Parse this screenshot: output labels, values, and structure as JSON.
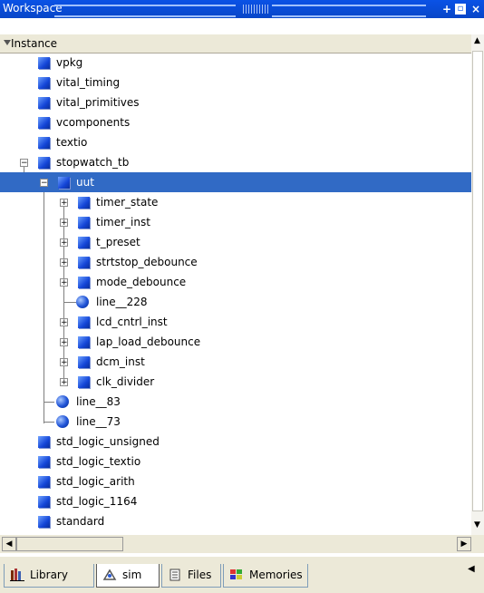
{
  "window": {
    "title": "Workspace",
    "add_glyph": "+",
    "restore_glyph": "▫",
    "close_glyph": "×"
  },
  "column_header": "Instance",
  "tree": [
    {
      "label": "vpkg",
      "icon": "module-icon"
    },
    {
      "label": "vital_timing",
      "icon": "module-icon"
    },
    {
      "label": "vital_primitives",
      "icon": "module-icon"
    },
    {
      "label": "vcomponents",
      "icon": "module-icon"
    },
    {
      "label": "textio",
      "icon": "module-icon"
    },
    {
      "label": "stopwatch_tb",
      "icon": "module-icon"
    },
    {
      "label": "uut",
      "icon": "module-icon"
    },
    {
      "label": "timer_state",
      "icon": "module-icon"
    },
    {
      "label": "timer_inst",
      "icon": "module-icon"
    },
    {
      "label": "t_preset",
      "icon": "module-icon"
    },
    {
      "label": "strtstop_debounce",
      "icon": "module-icon"
    },
    {
      "label": "mode_debounce",
      "icon": "module-icon"
    },
    {
      "label": "line__228",
      "icon": "process-icon"
    },
    {
      "label": "lcd_cntrl_inst",
      "icon": "module-icon"
    },
    {
      "label": "lap_load_debounce",
      "icon": "module-icon"
    },
    {
      "label": "dcm_inst",
      "icon": "module-icon"
    },
    {
      "label": "clk_divider",
      "icon": "module-icon"
    },
    {
      "label": "line__83",
      "icon": "process-icon"
    },
    {
      "label": "line__73",
      "icon": "process-icon"
    },
    {
      "label": "std_logic_unsigned",
      "icon": "module-icon"
    },
    {
      "label": "std_logic_textio",
      "icon": "module-icon"
    },
    {
      "label": "std_logic_arith",
      "icon": "module-icon"
    },
    {
      "label": "std_logic_1164",
      "icon": "module-icon"
    },
    {
      "label": "standard",
      "icon": "module-icon"
    }
  ],
  "expand_glyph": "+",
  "collapse_glyph": "−",
  "tabs": [
    {
      "label": "Library",
      "icon": "library-icon",
      "active": false
    },
    {
      "label": "sim",
      "icon": "sim-icon",
      "active": true
    },
    {
      "label": "Files",
      "icon": "files-icon",
      "active": false
    },
    {
      "label": "Memories",
      "icon": "memories-icon",
      "active": false
    }
  ],
  "colors": {
    "titlebar": "#0a52e6",
    "selection": "#316ac5",
    "icon_blue": "#1446d8"
  }
}
